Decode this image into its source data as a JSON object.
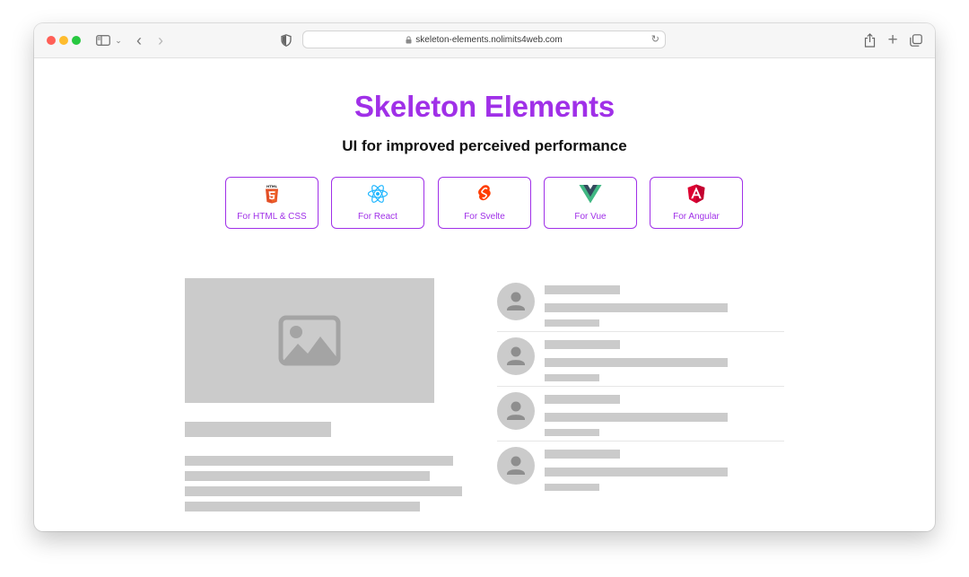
{
  "browser": {
    "url": "skeleton-elements.nolimits4web.com",
    "icons": {
      "sidebar": "sidebar-icon",
      "back": "chevron-left-icon",
      "forward": "chevron-right-icon",
      "privacy": "shield-icon",
      "lock": "lock-icon",
      "reload": "reload-icon",
      "share": "share-icon",
      "new_tab": "plus-icon",
      "tabs": "tabs-overview-icon"
    }
  },
  "page": {
    "title": "Skeleton Elements",
    "subtitle": "UI for improved perceived performance",
    "title_color": "#a030e8",
    "frameworks": [
      {
        "label": "For HTML & CSS",
        "icon": "html5-icon",
        "color": "#e34f26"
      },
      {
        "label": "For React",
        "icon": "react-icon",
        "color": "#1fb6ff"
      },
      {
        "label": "For Svelte",
        "icon": "svelte-icon",
        "color": "#ff3e00"
      },
      {
        "label": "For Vue",
        "icon": "vue-icon",
        "color": "#41b883"
      },
      {
        "label": "For Angular",
        "icon": "angular-icon",
        "color": "#dd0031"
      }
    ]
  },
  "skeleton": {
    "color": "#cbcbcb",
    "image_icon": "image-placeholder-icon",
    "avatar_icon": "user-placeholder-icon",
    "list_items": 4
  }
}
